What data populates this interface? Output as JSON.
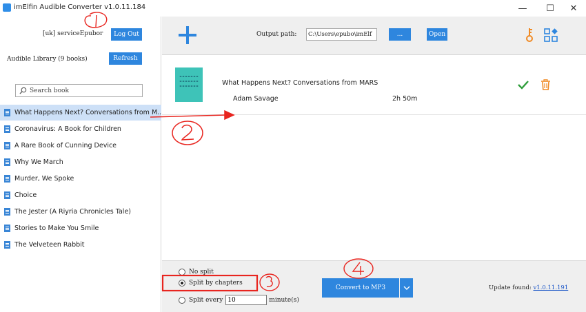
{
  "window": {
    "title": "imElfin Audible Converter v1.0.11.184",
    "minimize_glyph": "—",
    "maximize_glyph": "☐",
    "close_glyph": "✕"
  },
  "account": {
    "label": "[uk] serviceEpubor",
    "logout_label": "Log Out"
  },
  "library": {
    "label": "Audible Library (9 books)",
    "refresh_label": "Refresh",
    "search_placeholder": "Search book",
    "books": [
      "What Happens Next? Conversations from M...",
      "Coronavirus: A Book for Children",
      "A Rare Book of Cunning Device",
      "Why We March",
      "Murder, We Spoke",
      "Choice",
      "The Jester (A Riyria Chronicles Tale)",
      "Stories to Make You Smile",
      "The Velveteen Rabbit"
    ],
    "selected_index": 0
  },
  "toolbar": {
    "output_label": "Output path:",
    "output_path": "C:\\Users\\epubo\\imElf",
    "browse_label": "...",
    "open_label": "Open",
    "icons": [
      "add-icon",
      "key-icon",
      "apps-icon"
    ]
  },
  "queue": {
    "title": "What Happens Next? Conversations from MARS",
    "author": "Adam Savage",
    "duration": "2h 50m"
  },
  "split": {
    "options": [
      "No split",
      "Split by chapters",
      "Split every"
    ],
    "selected": "Split by chapters",
    "minutes_value": "10",
    "minutes_suffix": "minute(s)"
  },
  "convert": {
    "label": "Convert to MP3"
  },
  "update": {
    "label": "Update found:",
    "version": "v1.0.11.191"
  },
  "colors": {
    "accent": "#2e86de",
    "annotation": "#e8251f",
    "key": "#f08a24",
    "selected_row": "#cde0f7"
  }
}
